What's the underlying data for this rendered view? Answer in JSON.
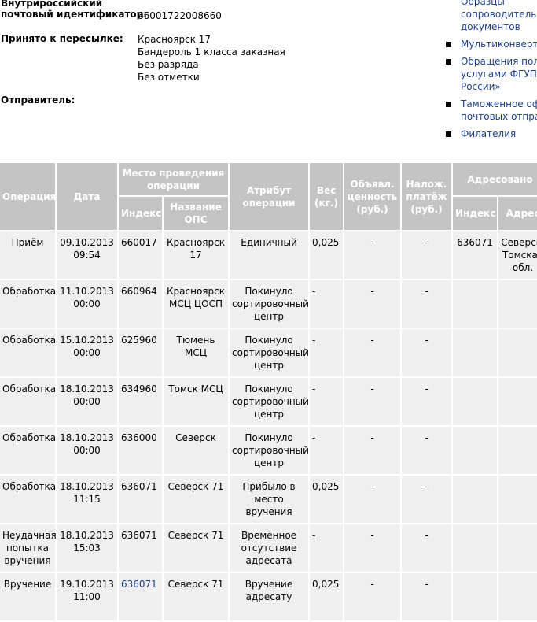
{
  "shipment": {
    "id_label_line1": "Внутрироссийский",
    "id_label_line2": "почтовый идентификатор:",
    "id_value": "66001722008660",
    "accepted_label": "Принято к пересылке:",
    "accepted_lines": [
      "Красноярск 17",
      "Бандероль 1 класса заказная",
      "Без разряда",
      "Без отметки"
    ],
    "sender_label": "Отправитель:"
  },
  "links": [
    {
      "lines": [
        "Образцы",
        "сопроводитель",
        "документов"
      ],
      "bullet": false
    },
    {
      "lines": [
        "Мультиконверт"
      ],
      "bullet": true
    },
    {
      "lines": [
        "Обращения поль",
        "услугами ФГУП «",
        "России»"
      ],
      "bullet": true
    },
    {
      "lines": [
        "Таможенное офо",
        "почтовых отправ"
      ],
      "bullet": true
    },
    {
      "lines": [
        "Филателия"
      ],
      "bullet": true
    }
  ],
  "table": {
    "headers": {
      "operation": "Операция",
      "date": "Дата",
      "place": "Место проведения операции",
      "place_index": "Индекс",
      "place_name": "Название ОПС",
      "attribute": "Атрибут операции",
      "weight": "Вес (кг.)",
      "declared": "Объявл. ценность (руб.)",
      "cod": "Налож. платёж (руб.)",
      "addressed": "Адресовано",
      "addr_index": "Индекс",
      "addr_address": "Адрес"
    },
    "rows": [
      {
        "operation": "Приём",
        "date": "09.10.2013 09:54",
        "index": "660017",
        "index_link": false,
        "ops": "Красноярск 17",
        "attribute": "Единичный",
        "weight": "0,025",
        "declared": "-",
        "cod": "-",
        "addr_index": "636071",
        "addr": "Северск, Томская обл."
      },
      {
        "operation": "Обработка",
        "date": "11.10.2013 00:00",
        "index": "660964",
        "index_link": false,
        "ops": "Красноярск МСЦ ЦОСП",
        "attribute": "Покинуло сортировочный центр",
        "weight": "-",
        "declared": "-",
        "cod": "-",
        "addr_index": "",
        "addr": ""
      },
      {
        "operation": "Обработка",
        "date": "15.10.2013 00:00",
        "index": "625960",
        "index_link": false,
        "ops": "Тюмень МСЦ",
        "attribute": "Покинуло сортировочный центр",
        "weight": "-",
        "declared": "-",
        "cod": "-",
        "addr_index": "",
        "addr": ""
      },
      {
        "operation": "Обработка",
        "date": "18.10.2013 00:00",
        "index": "634960",
        "index_link": false,
        "ops": "Томск МСЦ",
        "attribute": "Покинуло сортировочный центр",
        "weight": "-",
        "declared": "-",
        "cod": "-",
        "addr_index": "",
        "addr": ""
      },
      {
        "operation": "Обработка",
        "date": "18.10.2013 00:00",
        "index": "636000",
        "index_link": false,
        "ops": "Северск",
        "attribute": "Покинуло сортировочный центр",
        "weight": "-",
        "declared": "-",
        "cod": "-",
        "addr_index": "",
        "addr": ""
      },
      {
        "operation": "Обработка",
        "date": "18.10.2013 11:15",
        "index": "636071",
        "index_link": false,
        "ops": "Северск 71",
        "attribute": "Прибыло в место вручения",
        "weight": "0,025",
        "declared": "-",
        "cod": "-",
        "addr_index": "",
        "addr": ""
      },
      {
        "operation": "Неудачная попытка вручения",
        "date": "18.10.2013 15:03",
        "index": "636071",
        "index_link": false,
        "ops": "Северск 71",
        "attribute": "Временное отсутствие адресата",
        "weight": "-",
        "declared": "-",
        "cod": "-",
        "addr_index": "",
        "addr": ""
      },
      {
        "operation": "Вручение",
        "date": "19.10.2013 11:00",
        "index": "636071",
        "index_link": true,
        "ops": "Северск 71",
        "attribute": "Вручение адресату",
        "weight": "0,025",
        "declared": "-",
        "cod": "-",
        "addr_index": "",
        "addr": ""
      }
    ]
  }
}
